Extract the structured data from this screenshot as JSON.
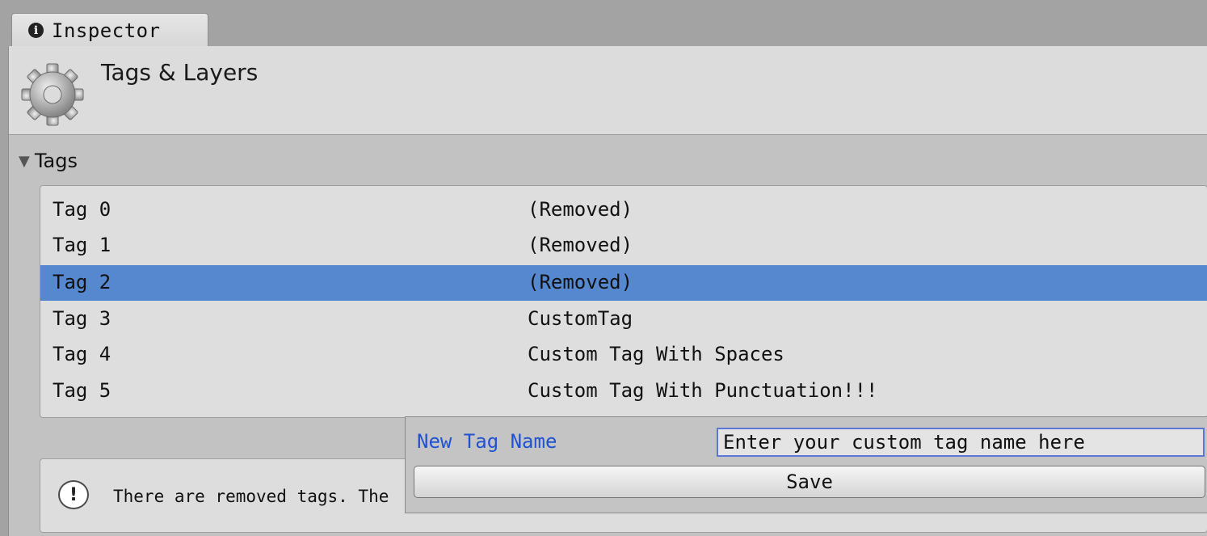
{
  "tab": {
    "label": "Inspector",
    "icon": "info-icon"
  },
  "header": {
    "title": "Tags & Layers",
    "icon": "gear-icon"
  },
  "section": {
    "title": "Tags",
    "expanded": true
  },
  "tags": [
    {
      "name": "Tag 0",
      "value": "(Removed)",
      "selected": false
    },
    {
      "name": "Tag 1",
      "value": "(Removed)",
      "selected": false
    },
    {
      "name": "Tag 2",
      "value": "(Removed)",
      "selected": true
    },
    {
      "name": "Tag 3",
      "value": "CustomTag",
      "selected": false
    },
    {
      "name": "Tag 4",
      "value": "Custom Tag With Spaces",
      "selected": false
    },
    {
      "name": "Tag 5",
      "value": "Custom Tag With Punctuation!!!",
      "selected": false
    }
  ],
  "help": {
    "text": "There are removed tags. The",
    "icon": "warning-icon"
  },
  "popup": {
    "label": "New Tag Name",
    "input_value": "Enter your custom tag name here",
    "save_label": "Save"
  },
  "colors": {
    "selection": "#5688cf",
    "label_blue": "#1f52d4",
    "input_border": "#5b78d8"
  }
}
